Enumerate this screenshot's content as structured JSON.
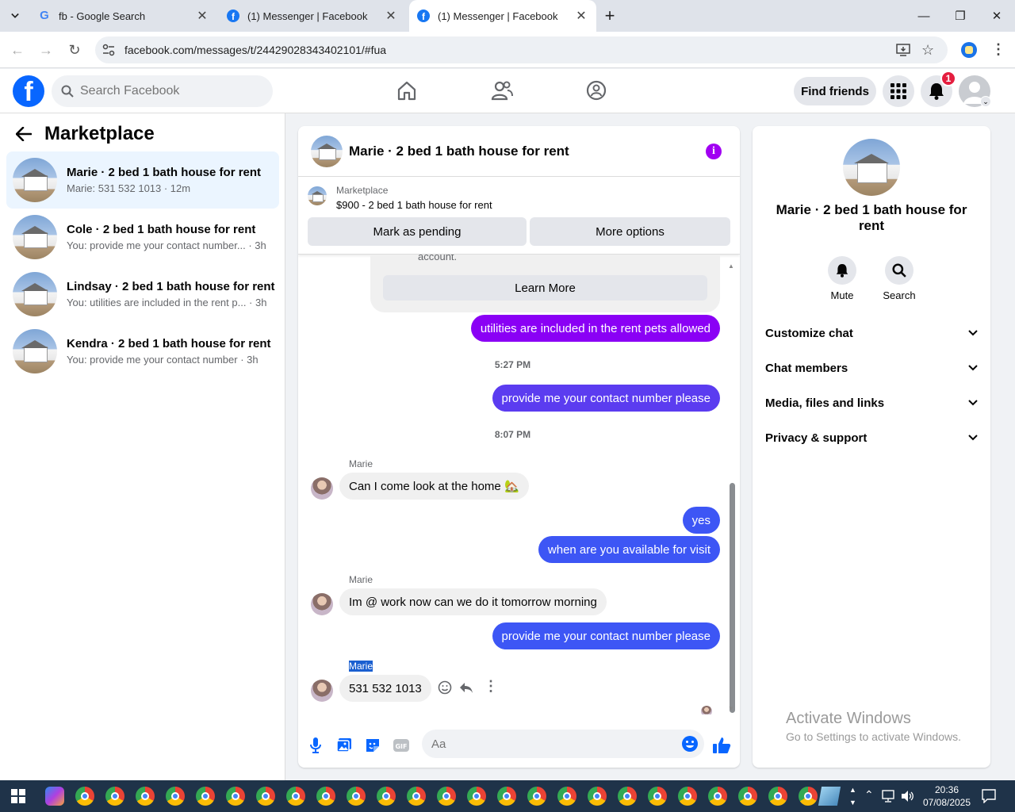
{
  "browser": {
    "tabs": [
      {
        "title": "fb - Google Search",
        "icon": "google-icon"
      },
      {
        "title": "(1) Messenger | Facebook",
        "icon": "facebook-icon"
      },
      {
        "title": "(1) Messenger | Facebook",
        "icon": "facebook-icon"
      }
    ],
    "url": "facebook.com/messages/t/24429028343402101/#fua"
  },
  "header": {
    "search_placeholder": "Search Facebook",
    "find_friends": "Find friends",
    "notification_count": "1"
  },
  "sidebar": {
    "title": "Marketplace",
    "conversations": [
      {
        "name": "Marie · 2 bed 1 bath house for rent",
        "preview": "Marie: 531 532 1013 · 12m",
        "selected": true
      },
      {
        "name": "Cole · 2 bed 1 bath house for rent",
        "preview": "You: provide me your contact number... · 3h"
      },
      {
        "name": "Lindsay · 2 bed 1 bath house for rent",
        "preview": "You: utilities are included in the rent p... · 3h"
      },
      {
        "name": "Kendra · 2 bed 1 bath house for rent",
        "preview": "You: provide me your contact number · 3h"
      }
    ]
  },
  "chat": {
    "title": "Marie · 2 bed 1 bath house for rent",
    "marketplace_label": "Marketplace",
    "listing": "$900 - 2 bed 1 bath house for rent",
    "mark_pending": "Mark as pending",
    "more_options": "More options",
    "notice_tail": "account.",
    "learn_more": "Learn More",
    "messages": [
      {
        "text": "utilities are included in the rent pets allowed"
      },
      {
        "time": "5:27 PM"
      },
      {
        "text": "provide me your contact number please"
      },
      {
        "time": "8:07 PM"
      },
      {
        "sender": "Marie",
        "text": "Can I come look at the home 🏡"
      },
      {
        "text": "yes"
      },
      {
        "text": "when are you available for visit"
      },
      {
        "sender": "Marie",
        "text": "Im @ work now can we do it tomorrow morning"
      },
      {
        "text": "provide me your contact number please"
      },
      {
        "sender": "Marie",
        "text": "531 532 1013"
      }
    ],
    "composer_placeholder": "Aa"
  },
  "details": {
    "title": "Marie · 2 bed 1 bath house for rent",
    "mute": "Mute",
    "search": "Search",
    "sections": [
      "Customize chat",
      "Chat members",
      "Media, files and links",
      "Privacy & support"
    ]
  },
  "watermark": {
    "line1": "Activate Windows",
    "line2": "Go to Settings to activate Windows."
  },
  "taskbar": {
    "time": "20:36",
    "date": "07/08/2025"
  },
  "colors": {
    "fb_blue": "#0866ff",
    "bubble_purple": "#8a00f5",
    "bubble_blue": "#3d56f5",
    "selected_bg": "#ebf5ff"
  }
}
